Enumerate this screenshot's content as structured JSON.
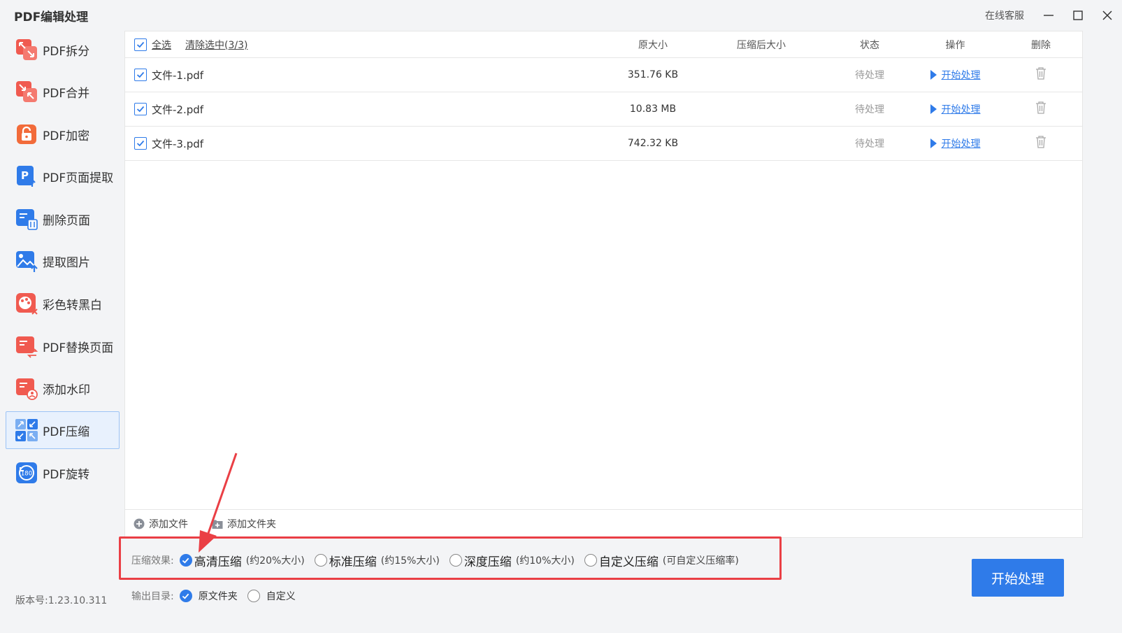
{
  "app": {
    "title": "PDF编辑处理",
    "support": "在线客服",
    "version": "版本号:1.23.10.311"
  },
  "sidebar": {
    "items": [
      {
        "label": "PDF拆分",
        "icon": "split-icon",
        "color": "#f05a50"
      },
      {
        "label": "PDF合并",
        "icon": "merge-icon",
        "color": "#f05a50"
      },
      {
        "label": "PDF加密",
        "icon": "lock-icon",
        "color": "#f26b3a"
      },
      {
        "label": "PDF页面提取",
        "icon": "page-extract-icon",
        "color": "#2f7be9"
      },
      {
        "label": "删除页面",
        "icon": "delete-page-icon",
        "color": "#2f7be9"
      },
      {
        "label": "提取图片",
        "icon": "image-extract-icon",
        "color": "#2f7be9"
      },
      {
        "label": "彩色转黑白",
        "icon": "palette-icon",
        "color": "#f05a50"
      },
      {
        "label": "PDF替换页面",
        "icon": "replace-page-icon",
        "color": "#f05a50"
      },
      {
        "label": "添加水印",
        "icon": "watermark-icon",
        "color": "#f05a50"
      },
      {
        "label": "PDF压缩",
        "icon": "compress-icon",
        "color": "#2f7be9"
      },
      {
        "label": "PDF旋转",
        "icon": "rotate-icon",
        "color": "#2f7be9",
        "badge": "180"
      }
    ],
    "active_index": 9
  },
  "table": {
    "select_all": "全选",
    "clear_selection": "清除选中(3/3)",
    "headers": {
      "orig_size": "原大小",
      "compressed_size": "压缩后大小",
      "status": "状态",
      "action": "操作",
      "delete": "删除"
    },
    "rows": [
      {
        "name": "文件-1.pdf",
        "size": "351.76 KB",
        "compressed": "",
        "status": "待处理",
        "action": "开始处理"
      },
      {
        "name": "文件-2.pdf",
        "size": "10.83 MB",
        "compressed": "",
        "status": "待处理",
        "action": "开始处理"
      },
      {
        "name": "文件-3.pdf",
        "size": "742.32 KB",
        "compressed": "",
        "status": "待处理",
        "action": "开始处理"
      }
    ]
  },
  "footer": {
    "add_file": "添加文件",
    "add_folder": "添加文件夹"
  },
  "compression": {
    "label": "压缩效果:",
    "options": [
      {
        "main": "高清压缩",
        "sub": "(约20%大小)",
        "selected": true
      },
      {
        "main": "标准压缩",
        "sub": "(约15%大小)",
        "selected": false
      },
      {
        "main": "深度压缩",
        "sub": "(约10%大小)",
        "selected": false
      },
      {
        "main": "自定义压缩",
        "sub": "(可自定义压缩率)",
        "selected": false
      }
    ]
  },
  "output": {
    "label": "输出目录:",
    "options": [
      {
        "label": "原文件夹",
        "selected": true
      },
      {
        "label": "自定义",
        "selected": false
      }
    ]
  },
  "start_button": "开始处理",
  "colors": {
    "accent": "#2f7be9",
    "highlight": "#ea3f45"
  }
}
